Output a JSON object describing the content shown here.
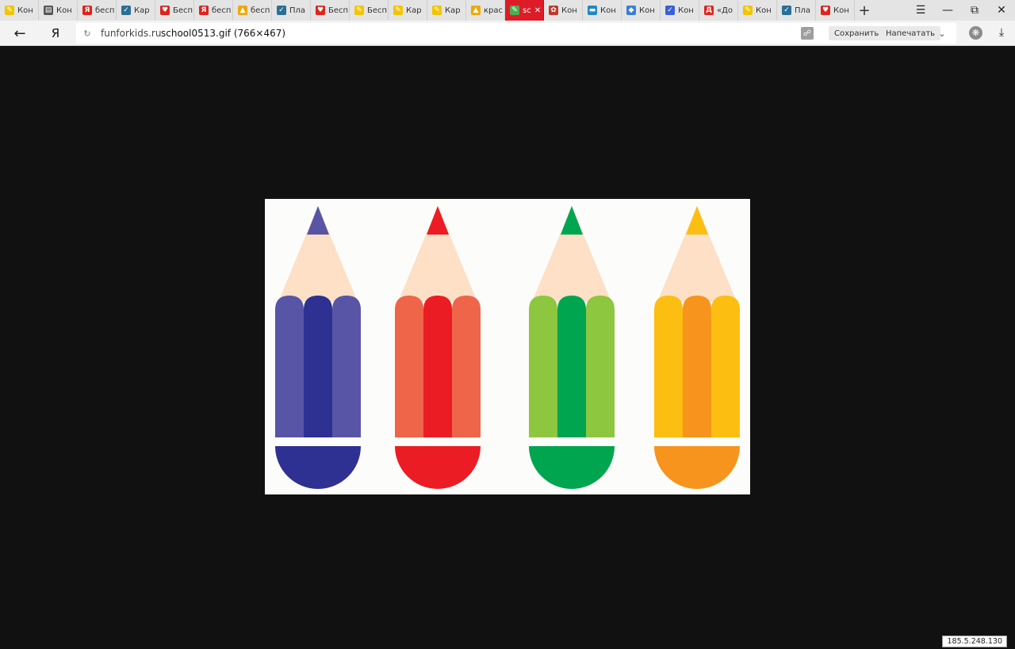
{
  "tabs": [
    {
      "label": "Кон",
      "icon": "yandex-pencil-icon",
      "color": "#f2c500"
    },
    {
      "label": "Кон",
      "icon": "page-icon",
      "color": "#555555"
    },
    {
      "label": "бесп",
      "icon": "yandex-icon",
      "color": "#e0231b"
    },
    {
      "label": "Кар",
      "icon": "check-icon",
      "color": "#2a6f97"
    },
    {
      "label": "Бесп",
      "icon": "heart-icon",
      "color": "#e0231b"
    },
    {
      "label": "бесп",
      "icon": "yandex-icon",
      "color": "#e0231b"
    },
    {
      "label": "бесп",
      "icon": "image-icon",
      "color": "#f0a800"
    },
    {
      "label": "Пла",
      "icon": "check-icon",
      "color": "#2a6f97"
    },
    {
      "label": "Бесп",
      "icon": "heart-icon",
      "color": "#e0231b"
    },
    {
      "label": "Бесп",
      "icon": "yandex-pencil-icon",
      "color": "#f2c500"
    },
    {
      "label": "Кар",
      "icon": "yandex-pencil-icon",
      "color": "#f2c500"
    },
    {
      "label": "Кар",
      "icon": "yandex-pencil-icon",
      "color": "#f2c500"
    },
    {
      "label": "крас",
      "icon": "image-icon",
      "color": "#f0a800"
    },
    {
      "label": "sc",
      "icon": "pencils-icon",
      "color": "#4caf50",
      "active": true
    },
    {
      "label": "Кон",
      "icon": "drawing-icon",
      "color": "#c0392b"
    },
    {
      "label": "Кон",
      "icon": "book-icon",
      "color": "#1e88c7"
    },
    {
      "label": "Кон",
      "icon": "diamond-icon",
      "color": "#3b7dd8"
    },
    {
      "label": "Кон",
      "icon": "check-icon",
      "color": "#3b5fd8"
    },
    {
      "label": "«До",
      "icon": "letter-d-icon",
      "color": "#e0231b"
    },
    {
      "label": "Кон",
      "icon": "yandex-pencil-icon",
      "color": "#f2c500"
    },
    {
      "label": "Пла",
      "icon": "check-icon",
      "color": "#2a6f97"
    },
    {
      "label": "Кон",
      "icon": "heart-icon",
      "color": "#e0231b"
    }
  ],
  "toolbar": {
    "logo": "Я",
    "domain": "funforkids.ru",
    "path": "school0513.gif (766×467)",
    "save_label": "Сохранить",
    "print_label": "Напечатать"
  },
  "image": {
    "background": "#fcfcfa",
    "tip_color": "#fde0c5",
    "pencils": [
      {
        "name": "blue",
        "lead": "#5855a6",
        "side": "#5855a6",
        "center": "#2e3092",
        "cap": "#2e3092"
      },
      {
        "name": "red",
        "lead": "#ec1c24",
        "side": "#ef6549",
        "center": "#ec1c24",
        "cap": "#ec1c24"
      },
      {
        "name": "green",
        "lead": "#00a550",
        "side": "#8dc63f",
        "center": "#00a550",
        "cap": "#00a550"
      },
      {
        "name": "yellow",
        "lead": "#fcbe10",
        "side": "#fcbe10",
        "center": "#f7941d",
        "cap": "#f7941d"
      }
    ]
  },
  "status": {
    "ip": "185.5.248.130"
  }
}
